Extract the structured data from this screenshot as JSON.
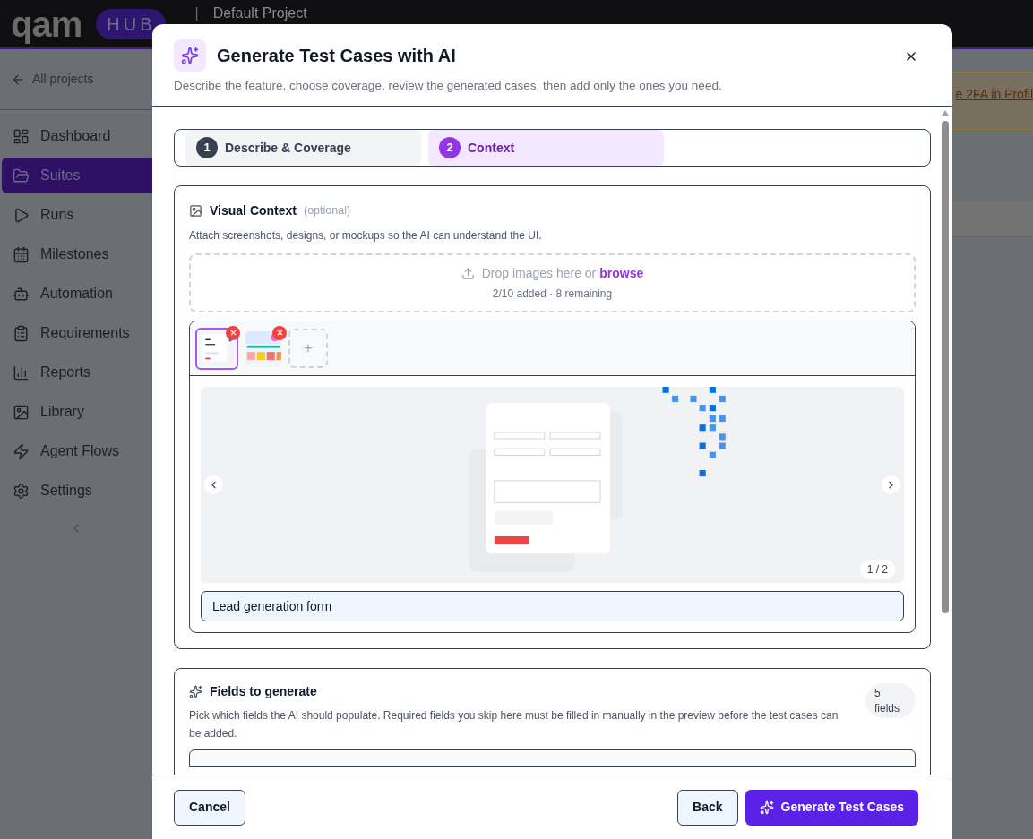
{
  "app": {
    "logo_text": "qam",
    "logo_badge": "HUB",
    "separator": "|",
    "project": "Default Project",
    "banner_link": "e 2FA in Profil"
  },
  "sidebar": {
    "back": "All projects",
    "items": [
      {
        "label": "Dashboard",
        "selected": false
      },
      {
        "label": "Suites",
        "selected": true
      },
      {
        "label": "Runs",
        "selected": false
      },
      {
        "label": "Milestones",
        "selected": false
      },
      {
        "label": "Automation",
        "selected": false
      },
      {
        "label": "Requirements",
        "selected": false
      },
      {
        "label": "Reports",
        "selected": false
      },
      {
        "label": "Library",
        "selected": false
      },
      {
        "label": "Agent Flows",
        "selected": false
      },
      {
        "label": "Settings",
        "selected": false
      }
    ]
  },
  "dialog": {
    "title": "Generate Test Cases with AI",
    "subtitle": "Describe the feature, choose coverage, review the generated cases, then add only the ones you need.",
    "steps": [
      {
        "number": "1",
        "label": "Describe & Coverage",
        "selected": false
      },
      {
        "number": "2",
        "label": "Context",
        "selected": true
      }
    ],
    "visual_context": {
      "title": "Visual Context",
      "optional": "(optional)",
      "description": "Attach screenshots, designs, or mockups so the AI can understand the UI.",
      "drop_text": "Drop images here or",
      "browse": "browse",
      "counter": "2/10 added · 8 remaining",
      "thumbnails": [
        {
          "kind": "picture",
          "selected": true
        },
        {
          "kind": "picture",
          "selected": false
        }
      ],
      "add": "+",
      "preview": {
        "kind": "picture"
      },
      "preview_counter": "1 / 2",
      "caption": "Lead generation form"
    },
    "fields": {
      "title": "Fields to generate",
      "description": "Pick which fields the AI should populate. Required fields you skip here must be filled in manually in the preview before the test cases can be added.",
      "count": "5",
      "count_unit": "fields"
    },
    "footer": {
      "cancel": "Cancel",
      "back": "Back",
      "generate": "Generate Test Cases"
    }
  }
}
